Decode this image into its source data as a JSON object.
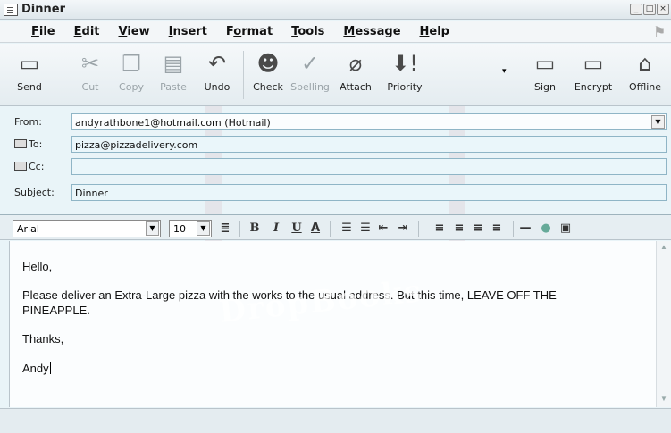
{
  "window": {
    "title": "Dinner"
  },
  "menu": [
    "File",
    "Edit",
    "View",
    "Insert",
    "Format",
    "Tools",
    "Message",
    "Help"
  ],
  "menu_accel": [
    "F",
    "E",
    "V",
    "I",
    "o",
    "T",
    "M",
    "H"
  ],
  "toolbar": {
    "send": "Send",
    "cut": "Cut",
    "copy": "Copy",
    "paste": "Paste",
    "undo": "Undo",
    "check": "Check",
    "spelling": "Spelling",
    "attach": "Attach",
    "priority": "Priority",
    "sign": "Sign",
    "encrypt": "Encrypt",
    "offline": "Offline"
  },
  "header": {
    "from_label": "From:",
    "from_value": "andyrathbone1@hotmail.com   (Hotmail)",
    "to_label": "To:",
    "to_value": "pizza@pizzadelivery.com",
    "cc_label": "Cc:",
    "cc_value": "",
    "subject_label": "Subject:",
    "subject_value": "Dinner"
  },
  "format": {
    "font": "Arial",
    "size": "10"
  },
  "body": {
    "greeting": "Hello,",
    "line1": "Please deliver an Extra-Large pizza with the works to the usual address. But this time, LEAVE OFF THE",
    "line2": "PINEAPPLE.",
    "thanks": "Thanks,",
    "signature": "Andy"
  },
  "watermark": "DropBooks"
}
